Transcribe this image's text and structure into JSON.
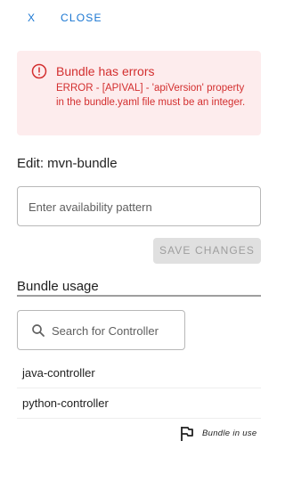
{
  "topbar": {
    "close_x": "X",
    "close_label": "CLOSE"
  },
  "alert": {
    "icon": "error-circle-icon",
    "title": "Bundle has errors",
    "message": "ERROR - [APIVAL] - 'apiVersion' property in the bundle.yaml file must be an integer.",
    "color": "#d32f2f",
    "background": "#fdeced"
  },
  "edit": {
    "title": "Edit: mvn-bundle",
    "pattern_placeholder": "Enter availability pattern",
    "pattern_value": "",
    "save_label": "SAVE CHANGES"
  },
  "usage": {
    "title": "Bundle usage",
    "search_placeholder": "Search for Controller",
    "search_value": "",
    "controllers": [
      {
        "name": "java-controller"
      },
      {
        "name": "python-controller"
      }
    ],
    "in_use_label": "Bundle in use",
    "in_use_icon": "flag-icon"
  },
  "accent_color": "#1976d2"
}
